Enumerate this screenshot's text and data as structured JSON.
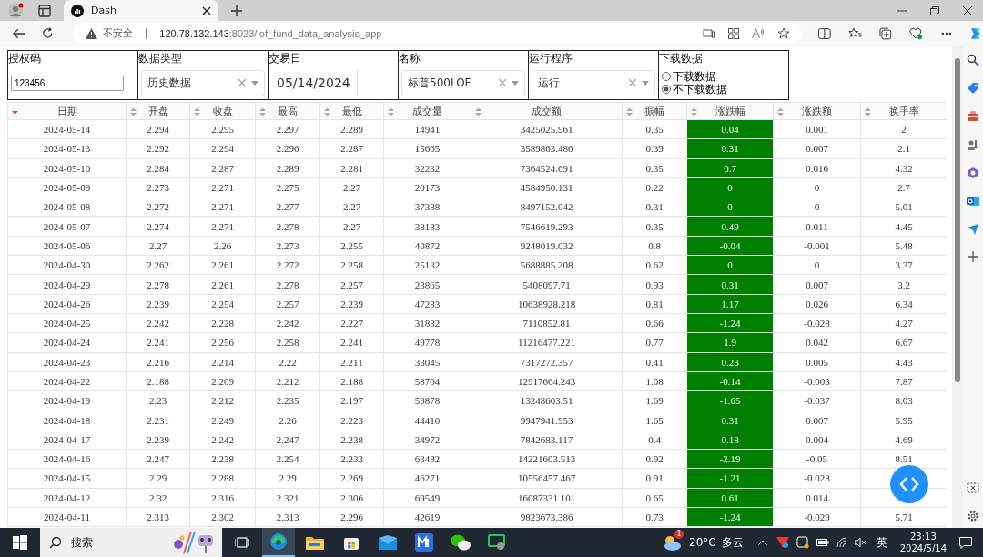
{
  "browser": {
    "tabs": [
      {
        "title": "Dash",
        "selected": true
      }
    ],
    "security": "不安全",
    "url_host": "120.78.132.143",
    "url_path": ":8023/lof_fund_data_analysis_app"
  },
  "controls": [
    {
      "kind": "text",
      "label": "授权码",
      "value": "123456"
    },
    {
      "kind": "dropdown",
      "label": "数据类型",
      "value": "历史数据"
    },
    {
      "kind": "date",
      "label": "交易日",
      "value": "05/14/2024"
    },
    {
      "kind": "dropdown",
      "label": "名称",
      "value": "标普500LOF"
    },
    {
      "kind": "dropdown",
      "label": "运行程序",
      "value": "运行"
    },
    {
      "kind": "radio",
      "label": "下载数据",
      "options": [
        {
          "label": "下载数据",
          "selected": false
        },
        {
          "label": "不下载数据",
          "selected": true
        }
      ]
    }
  ],
  "table": {
    "columns": [
      {
        "label": "日期",
        "sorted_desc": true,
        "highlight": false
      },
      {
        "label": "开盘",
        "sorted_desc": false,
        "highlight": false
      },
      {
        "label": "收盘",
        "sorted_desc": false,
        "highlight": false
      },
      {
        "label": "最高",
        "sorted_desc": false,
        "highlight": false
      },
      {
        "label": "最低",
        "sorted_desc": false,
        "highlight": false
      },
      {
        "label": "成交量",
        "sorted_desc": false,
        "highlight": false
      },
      {
        "label": "成交额",
        "sorted_desc": false,
        "highlight": false
      },
      {
        "label": "振幅",
        "sorted_desc": false,
        "highlight": false
      },
      {
        "label": "涨跌幅",
        "sorted_desc": false,
        "highlight": true
      },
      {
        "label": "涨跌额",
        "sorted_desc": false,
        "highlight": false
      },
      {
        "label": "换手率",
        "sorted_desc": false,
        "highlight": false
      }
    ],
    "rows": [
      [
        "2024-05-14",
        "2.294",
        "2.295",
        "2.297",
        "2.289",
        "14941",
        "3425025.961",
        "0.35",
        "0.04",
        "0.001",
        "2"
      ],
      [
        "2024-05-13",
        "2.292",
        "2.294",
        "2.296",
        "2.287",
        "15665",
        "3589863.486",
        "0.39",
        "0.31",
        "0.007",
        "2.1"
      ],
      [
        "2024-05-10",
        "2.284",
        "2.287",
        "2.289",
        "2.281",
        "32232",
        "7364524.691",
        "0.35",
        "0.7",
        "0.016",
        "4.32"
      ],
      [
        "2024-05-09",
        "2.273",
        "2.271",
        "2.275",
        "2.27",
        "20173",
        "4584950.131",
        "0.22",
        "0",
        "0",
        "2.7"
      ],
      [
        "2024-05-08",
        "2.272",
        "2.271",
        "2.277",
        "2.27",
        "37388",
        "8497152.042",
        "0.31",
        "0",
        "0",
        "5.01"
      ],
      [
        "2024-05-07",
        "2.274",
        "2.271",
        "2.278",
        "2.27",
        "33183",
        "7546619.293",
        "0.35",
        "0.49",
        "0.011",
        "4.45"
      ],
      [
        "2024-05-06",
        "2.27",
        "2.26",
        "2.273",
        "2.255",
        "40872",
        "9248019.032",
        "0.8",
        "-0.04",
        "-0.001",
        "5.48"
      ],
      [
        "2024-04-30",
        "2.262",
        "2.261",
        "2.272",
        "2.258",
        "25132",
        "5688885.208",
        "0.62",
        "0",
        "0",
        "3.37"
      ],
      [
        "2024-04-29",
        "2.278",
        "2.261",
        "2.278",
        "2.257",
        "23865",
        "5408097.71",
        "0.93",
        "0.31",
        "0.007",
        "3.2"
      ],
      [
        "2024-04-26",
        "2.239",
        "2.254",
        "2.257",
        "2.239",
        "47283",
        "10638928.218",
        "0.81",
        "1.17",
        "0.026",
        "6.34"
      ],
      [
        "2024-04-25",
        "2.242",
        "2.228",
        "2.242",
        "2.227",
        "31882",
        "7110852.81",
        "0.66",
        "-1.24",
        "-0.028",
        "4.27"
      ],
      [
        "2024-04-24",
        "2.241",
        "2.256",
        "2.258",
        "2.241",
        "49778",
        "11216477.221",
        "0.77",
        "1.9",
        "0.042",
        "6.67"
      ],
      [
        "2024-04-23",
        "2.216",
        "2.214",
        "2.22",
        "2.211",
        "33045",
        "7317272.357",
        "0.41",
        "0.23",
        "0.005",
        "4.43"
      ],
      [
        "2024-04-22",
        "2.188",
        "2.209",
        "2.212",
        "2.188",
        "58704",
        "12917664.243",
        "1.08",
        "-0.14",
        "-0.003",
        "7.87"
      ],
      [
        "2024-04-19",
        "2.23",
        "2.212",
        "2.235",
        "2.197",
        "59878",
        "13248603.51",
        "1.69",
        "-1.65",
        "-0.037",
        "8.03"
      ],
      [
        "2024-04-18",
        "2.231",
        "2.249",
        "2.26",
        "2.223",
        "44410",
        "9947941.953",
        "1.65",
        "0.31",
        "0.007",
        "5.95"
      ],
      [
        "2024-04-17",
        "2.239",
        "2.242",
        "2.247",
        "2.238",
        "34972",
        "7842683.117",
        "0.4",
        "0.18",
        "0.004",
        "4.69"
      ],
      [
        "2024-04-16",
        "2.247",
        "2.238",
        "2.254",
        "2.233",
        "63482",
        "14221603.513",
        "0.92",
        "-2.19",
        "-0.05",
        "8.51"
      ],
      [
        "2024-04-15",
        "2.29",
        "2.288",
        "2.29",
        "2.269",
        "46271",
        "10556457.467",
        "0.91",
        "-1.21",
        "-0.028"
      ],
      [
        "2024-04-12",
        "2.32",
        "2.316",
        "2.321",
        "2.306",
        "69549",
        "16087331.101",
        "0.65",
        "0.61",
        "0.014"
      ],
      [
        "2024-04-11",
        "2.313",
        "2.302",
        "2.313",
        "2.296",
        "42619",
        "9823673.386",
        "0.73",
        "-1.24",
        "-0.029",
        "5.71"
      ]
    ]
  },
  "taskbar": {
    "search_placeholder": "搜索",
    "apps": [
      {
        "kind": "taskview",
        "selected": false
      },
      {
        "kind": "edge",
        "selected": true
      },
      {
        "kind": "folder",
        "selected": false
      },
      {
        "kind": "store",
        "selected": false
      },
      {
        "kind": "mail",
        "selected": false
      },
      {
        "kind": "m",
        "selected": false
      },
      {
        "kind": "wechat",
        "selected": false
      },
      {
        "kind": "green",
        "selected": false
      }
    ],
    "weather": {
      "badge": "1",
      "temp": "20°C",
      "condition": "多云"
    },
    "ime": "英",
    "time": "23:13",
    "date": "2024/5/14"
  }
}
